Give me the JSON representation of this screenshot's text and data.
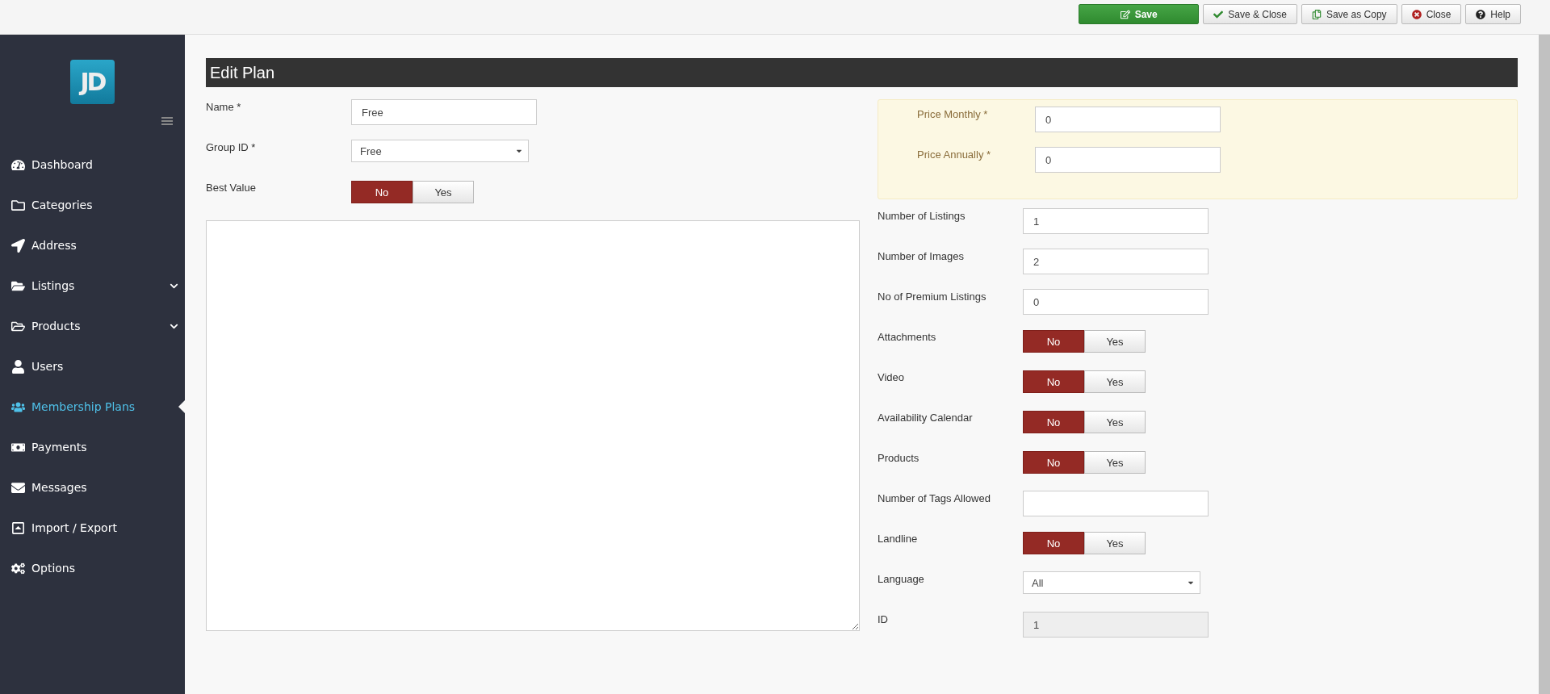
{
  "toolbar": {
    "buttons": [
      {
        "label": "Save",
        "kind": "primary"
      },
      {
        "label": "Save & Close",
        "kind": "default"
      },
      {
        "label": "Save as Copy",
        "kind": "default"
      },
      {
        "label": "Close",
        "kind": "default"
      },
      {
        "label": "Help",
        "kind": "default"
      }
    ]
  },
  "sidebar": {
    "logo": "JD",
    "items": [
      {
        "label": "Dashboard",
        "selected": false,
        "expandable": false
      },
      {
        "label": "Categories",
        "selected": false,
        "expandable": false
      },
      {
        "label": "Address",
        "selected": false,
        "expandable": false
      },
      {
        "label": "Listings",
        "selected": false,
        "expandable": true
      },
      {
        "label": "Products",
        "selected": false,
        "expandable": true
      },
      {
        "label": "Users",
        "selected": false,
        "expandable": false
      },
      {
        "label": "Membership Plans",
        "selected": true,
        "expandable": false
      },
      {
        "label": "Payments",
        "selected": false,
        "expandable": false
      },
      {
        "label": "Messages",
        "selected": false,
        "expandable": false
      },
      {
        "label": "Import / Export",
        "selected": false,
        "expandable": false
      },
      {
        "label": "Options",
        "selected": false,
        "expandable": false
      }
    ]
  },
  "title": "Edit Plan",
  "left_fields": [
    {
      "label": "Name *",
      "kind": "text",
      "value": "Free"
    },
    {
      "label": "Group ID *",
      "kind": "select",
      "value": "Free"
    },
    {
      "label": "Best Value",
      "kind": "toggle",
      "options": [
        {
          "label": "No",
          "selected": true
        },
        {
          "label": "Yes",
          "selected": false
        }
      ]
    }
  ],
  "price_fields": [
    {
      "label": "Price Monthly *",
      "kind": "text",
      "value": "0"
    },
    {
      "label": "Price Annually *",
      "kind": "text",
      "value": "0"
    }
  ],
  "right_fields": [
    {
      "label": "Number of Listings",
      "kind": "text",
      "value": "1"
    },
    {
      "label": "Number of Images",
      "kind": "text",
      "value": "2"
    },
    {
      "label": "No of Premium Listings",
      "kind": "text",
      "value": "0"
    },
    {
      "label": "Attachments",
      "kind": "toggle",
      "options": [
        {
          "label": "No",
          "selected": true
        },
        {
          "label": "Yes",
          "selected": false
        }
      ]
    },
    {
      "label": "Video",
      "kind": "toggle",
      "options": [
        {
          "label": "No",
          "selected": true
        },
        {
          "label": "Yes",
          "selected": false
        }
      ]
    },
    {
      "label": "Availability Calendar",
      "kind": "toggle",
      "options": [
        {
          "label": "No",
          "selected": true
        },
        {
          "label": "Yes",
          "selected": false
        }
      ]
    },
    {
      "label": "Products",
      "kind": "toggle",
      "options": [
        {
          "label": "No",
          "selected": true
        },
        {
          "label": "Yes",
          "selected": false
        }
      ]
    },
    {
      "label": "Number of Tags Allowed",
      "kind": "text"
    },
    {
      "label": "Landline",
      "kind": "toggle",
      "options": [
        {
          "label": "No",
          "selected": true
        },
        {
          "label": "Yes",
          "selected": false
        }
      ]
    },
    {
      "label": "Language",
      "kind": "select",
      "value": "All"
    },
    {
      "label": "ID",
      "kind": "readonly",
      "value": "1"
    }
  ]
}
